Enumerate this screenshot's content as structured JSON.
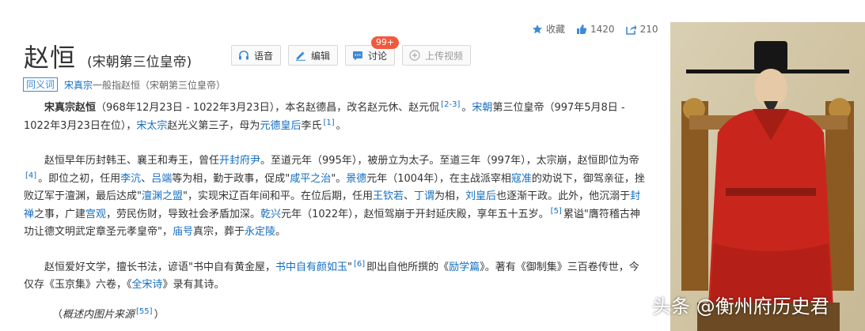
{
  "stats": {
    "favorite_label": "收藏",
    "like_count": "1420",
    "share_count": "210"
  },
  "header": {
    "title": "赵恒",
    "subtitle": "(宋朝第三位皇帝)"
  },
  "actions": {
    "voice_label": "语音",
    "edit_label": "编辑",
    "discuss_label": "讨论",
    "discuss_badge": "99+",
    "upload_label": "上传视频"
  },
  "synonym": {
    "tag": "同义词",
    "term": "宋真宗",
    "desc": "一般指赵恒（宋朝第三位皇帝）"
  },
  "paragraphs": {
    "p1": {
      "t1": "宋真宗赵恒",
      "t2": "（968年12月23日 - 1022年3月23日），本名赵德昌，改名赵元休、赵元侃",
      "ref1": "[2-3]",
      "t3": "。",
      "l1": "宋朝",
      "t4": "第三位皇帝（997年5月8日 - 1022年3月23日在位），",
      "l2": "宋太宗",
      "t5": "赵光义第三子，母为",
      "l3": "元德皇后",
      "t6": "李氏",
      "ref2": "[1]",
      "t7": "。"
    },
    "p2": {
      "t1": "赵恒早年历封韩王、襄王和寿王，曾任",
      "l1": "开封府尹",
      "t2": "。至道元年（995年），被册立为太子。至道三年（997年），太宗崩，赵恒即位为帝",
      "ref1": "[4]",
      "t3": "。即位之初，任用",
      "l2": "李沆",
      "t4": "、",
      "l3": "吕端",
      "t5": "等为相，勤于政事，促成\"",
      "l4": "咸平之治",
      "t6": "\"。",
      "l5": "景德",
      "t7": "元年（1004年），在主战派宰相",
      "l6": "寇准",
      "t8": "的劝说下，御驾亲征，挫败辽军于澶渊，最后达成\"",
      "l7": "澶渊之盟",
      "t9": "\"，实现宋辽百年间和平。在位后期，任用",
      "l8": "王钦若",
      "t10": "、",
      "l9": "丁谓",
      "t11": "为相，",
      "l10": "刘皇后",
      "t12": "也逐渐干政。此外，他沉溺于",
      "l11": "封禅",
      "t13": "之事，广建",
      "l12": "宫观",
      "t14": "，劳民伤财，导致社会矛盾加深。",
      "l13": "乾兴",
      "t15": "元年（1022年），赵恒驾崩于开封延庆殿，享年五十五岁。",
      "ref2": "[5]",
      "t16": "累谥\"膺符稽古神功让德文明武定章圣元孝皇帝\"，",
      "l14": "庙号",
      "t17": "真宗，葬于",
      "l15": "永定陵",
      "t18": "。"
    },
    "p3": {
      "t1": "赵恒爱好文学，擅长书法，谚语\"书中自有黄金屋，",
      "l1": "书中自有颜如玉",
      "t2": "\"",
      "ref1": "[6]",
      "t3": "即出自他所撰的《",
      "l2": "励学篇",
      "t4": "》。著有《御制集》三百卷传世，今仅存《玉京集》六卷，《",
      "l3": "全宋诗",
      "t5": "》录有其诗。"
    },
    "source": {
      "open": "（",
      "text": "概述内图片来源",
      "ref": "[55]",
      "close": "）"
    }
  },
  "watermark": "头条 @衡州府历史君",
  "colors": {
    "link": "#136ec2",
    "badge": "#f05a3c",
    "robe": "#c8261c"
  }
}
